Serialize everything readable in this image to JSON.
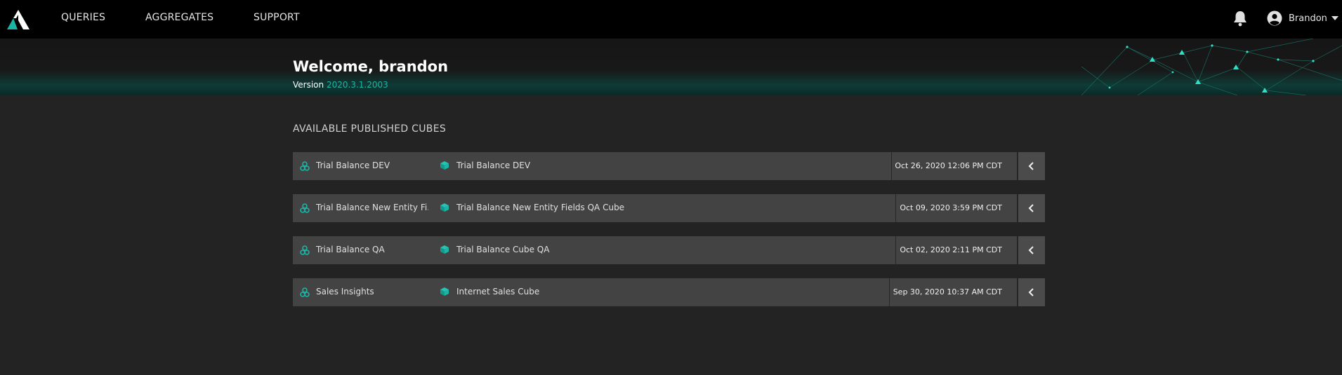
{
  "nav": {
    "logo": "atscale-logo-icon",
    "items": [
      {
        "label": "QUERIES"
      },
      {
        "label": "AGGREGATES"
      },
      {
        "label": "SUPPORT"
      }
    ],
    "notifications_icon": "bell-icon",
    "user": {
      "name": "Brandon",
      "icon": "user-circle-icon"
    }
  },
  "banner": {
    "welcome": "Welcome, brandon",
    "version_label": "Version",
    "version_number": "2020.3.1.2003"
  },
  "section": {
    "title": "AVAILABLE PUBLISHED CUBES"
  },
  "cubes": [
    {
      "query_name": "Trial Balance DEV",
      "cube_name": "Trial Balance DEV",
      "date": "Oct 26, 2020 12:06 PM CDT"
    },
    {
      "query_name": "Trial Balance New Entity Fi...",
      "cube_name": "Trial Balance New Entity Fields QA Cube",
      "date": "Oct 09, 2020 3:59 PM CDT"
    },
    {
      "query_name": "Trial Balance QA",
      "cube_name": "Trial Balance Cube QA",
      "date": "Oct 02, 2020 2:11 PM CDT"
    },
    {
      "query_name": "Sales Insights",
      "cube_name": "Internet Sales Cube",
      "date": "Sep 30, 2020 10:37 AM CDT"
    }
  ],
  "colors": {
    "accent": "#1bb5a6",
    "topbar": "#000000",
    "background": "#232323",
    "row": "#434343"
  }
}
